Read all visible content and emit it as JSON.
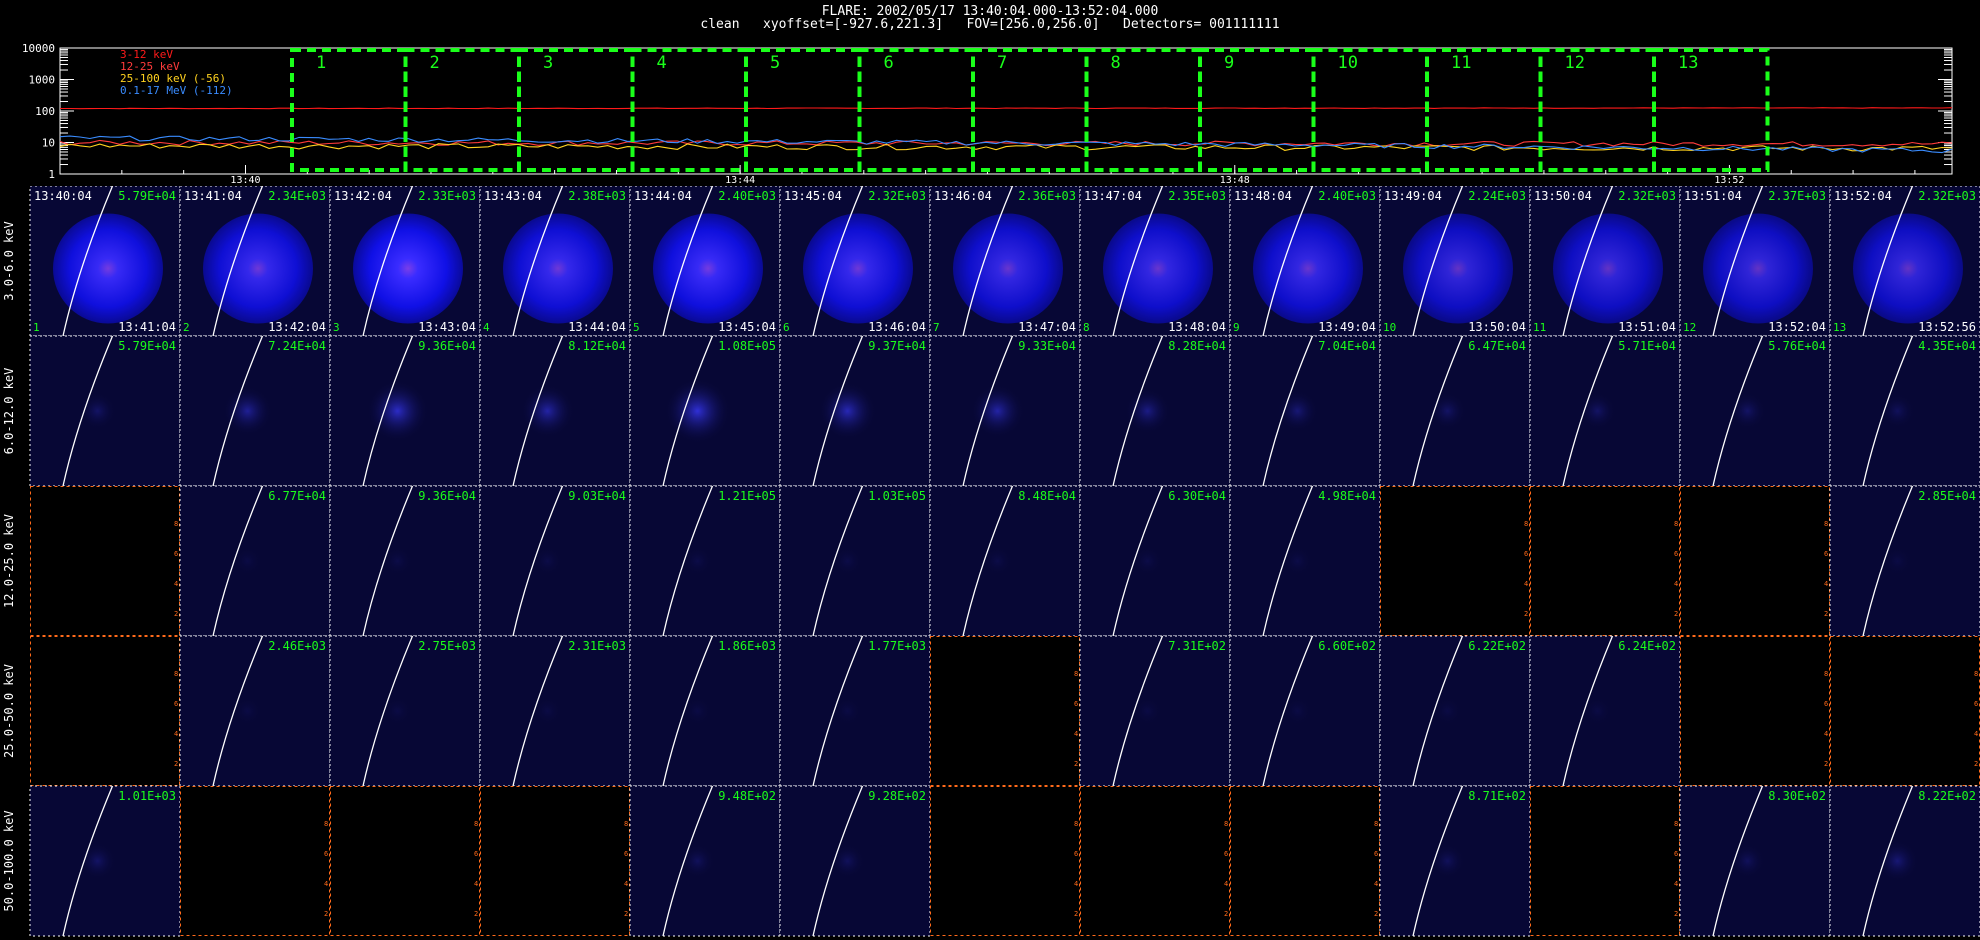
{
  "header": {
    "line1": "FLARE: 2002/05/17 13:40:04.000-13:52:04.000",
    "line2": "clean   xyoffset=[-927.6,221.3]   FOV=[256.0,256.0]   Detectors= 001111111"
  },
  "lightcurve": {
    "y_ticks": [
      "10000",
      "1000",
      "100",
      "10",
      "1"
    ],
    "x_ticks": [
      "13:40",
      "13:44",
      "13:48",
      "13:52"
    ],
    "legend": [
      {
        "label": "3-12 keV",
        "color": "#ff1a1a"
      },
      {
        "label": "12-25 keV",
        "color": "#ff3b3b"
      },
      {
        "label": "25-100 keV (-56)",
        "color": "#ffd21f"
      },
      {
        "label": "0.1-17 MeV (-112)",
        "color": "#3a8cff"
      }
    ],
    "interval_color": "#1aff1a",
    "interval_labels": [
      "1",
      "2",
      "3",
      "4",
      "5",
      "6",
      "7",
      "8",
      "9",
      "10",
      "11",
      "12",
      "13"
    ]
  },
  "chart_data": {
    "type": "line",
    "title": "",
    "xlabel": "",
    "ylabel": "",
    "x": [
      "13:40",
      "13:44",
      "13:48",
      "13:52"
    ],
    "scale": "log",
    "ylim": [
      1,
      10000
    ],
    "series": [
      {
        "name": "3-12 keV",
        "values": [
          120,
          120,
          125,
          125
        ]
      },
      {
        "name": "12-25 keV",
        "values": [
          11,
          10,
          8,
          9
        ]
      },
      {
        "name": "25-100 keV (-56)",
        "values": [
          9,
          8,
          6,
          7
        ]
      },
      {
        "name": "0.1-17 MeV (-112)",
        "values": [
          14,
          9,
          7,
          6
        ]
      }
    ]
  },
  "grid": {
    "energy_bands": [
      "3.0-6.0 keV",
      "6.0-12.0 keV",
      "12.0-25.0 keV",
      "25.0-50.0 keV",
      "50.0-100.0 keV"
    ],
    "start_times": [
      "13:40:04",
      "13:41:04",
      "13:42:04",
      "13:43:04",
      "13:44:04",
      "13:45:04",
      "13:46:04",
      "13:47:04",
      "13:48:04",
      "13:49:04",
      "13:50:04",
      "13:51:04",
      "13:52:04"
    ],
    "end_times": [
      "13:41:04",
      "13:42:04",
      "13:43:04",
      "13:44:04",
      "13:45:04",
      "13:46:04",
      "13:47:04",
      "13:48:04",
      "13:49:04",
      "13:50:04",
      "13:51:04",
      "13:52:04",
      "13:52:56"
    ],
    "peaks": [
      [
        "5.79E+04",
        "2.34E+03",
        "2.33E+03",
        "2.38E+03",
        "2.40E+03",
        "2.32E+03",
        "2.36E+03",
        "2.35E+03",
        "2.40E+03",
        "2.24E+03",
        "2.32E+03",
        "2.37E+03",
        "2.32E+03"
      ],
      [
        "5.79E+04",
        "7.24E+04",
        "9.36E+04",
        "8.12E+04",
        "1.08E+05",
        "9.37E+04",
        "9.33E+04",
        "8.28E+04",
        "7.04E+04",
        "6.47E+04",
        "5.71E+04",
        "5.76E+04",
        "4.35E+04"
      ],
      [
        "",
        "6.77E+04",
        "9.36E+04",
        "9.03E+04",
        "1.21E+05",
        "1.03E+05",
        "8.48E+04",
        "6.30E+04",
        "4.98E+04",
        "",
        "",
        "",
        "2.85E+04"
      ],
      [
        "",
        "2.46E+03",
        "2.75E+03",
        "2.31E+03",
        "1.86E+03",
        "1.77E+03",
        "",
        "7.31E+02",
        "6.60E+02",
        "6.22E+02",
        "6.24E+02",
        "",
        ""
      ],
      [
        "1.01E+03",
        "",
        "",
        "",
        "9.48E+02",
        "9.28E+02",
        "",
        "",
        "",
        "8.71E+02",
        "",
        "8.30E+02",
        "8.22E+02"
      ]
    ],
    "intensity": [
      [
        0.95,
        0.9,
        1.0,
        0.9,
        0.95,
        0.9,
        0.85,
        0.85,
        0.85,
        0.8,
        0.8,
        0.8,
        0.8
      ],
      [
        0.15,
        0.3,
        0.45,
        0.35,
        0.5,
        0.4,
        0.35,
        0.25,
        0.2,
        0.15,
        0.15,
        0.15,
        0.12
      ],
      [
        0,
        0.05,
        0.06,
        0.06,
        0.06,
        0.06,
        0.06,
        0.06,
        0.06,
        0,
        0,
        0,
        0.05
      ],
      [
        0,
        0.05,
        0.05,
        0.05,
        0.05,
        0.05,
        0,
        0.05,
        0.05,
        0.05,
        0.05,
        0,
        0
      ],
      [
        0.15,
        0,
        0,
        0,
        0.12,
        0.12,
        0,
        0,
        0,
        0.12,
        0,
        0.12,
        0.2
      ]
    ],
    "axis_ticks": [
      "2",
      "4",
      "6",
      "8"
    ],
    "colors": {
      "time": "#ffffff",
      "peak": "#1aff1a",
      "empty_border": "#ff6a1a",
      "limb": "#ffffff"
    }
  }
}
